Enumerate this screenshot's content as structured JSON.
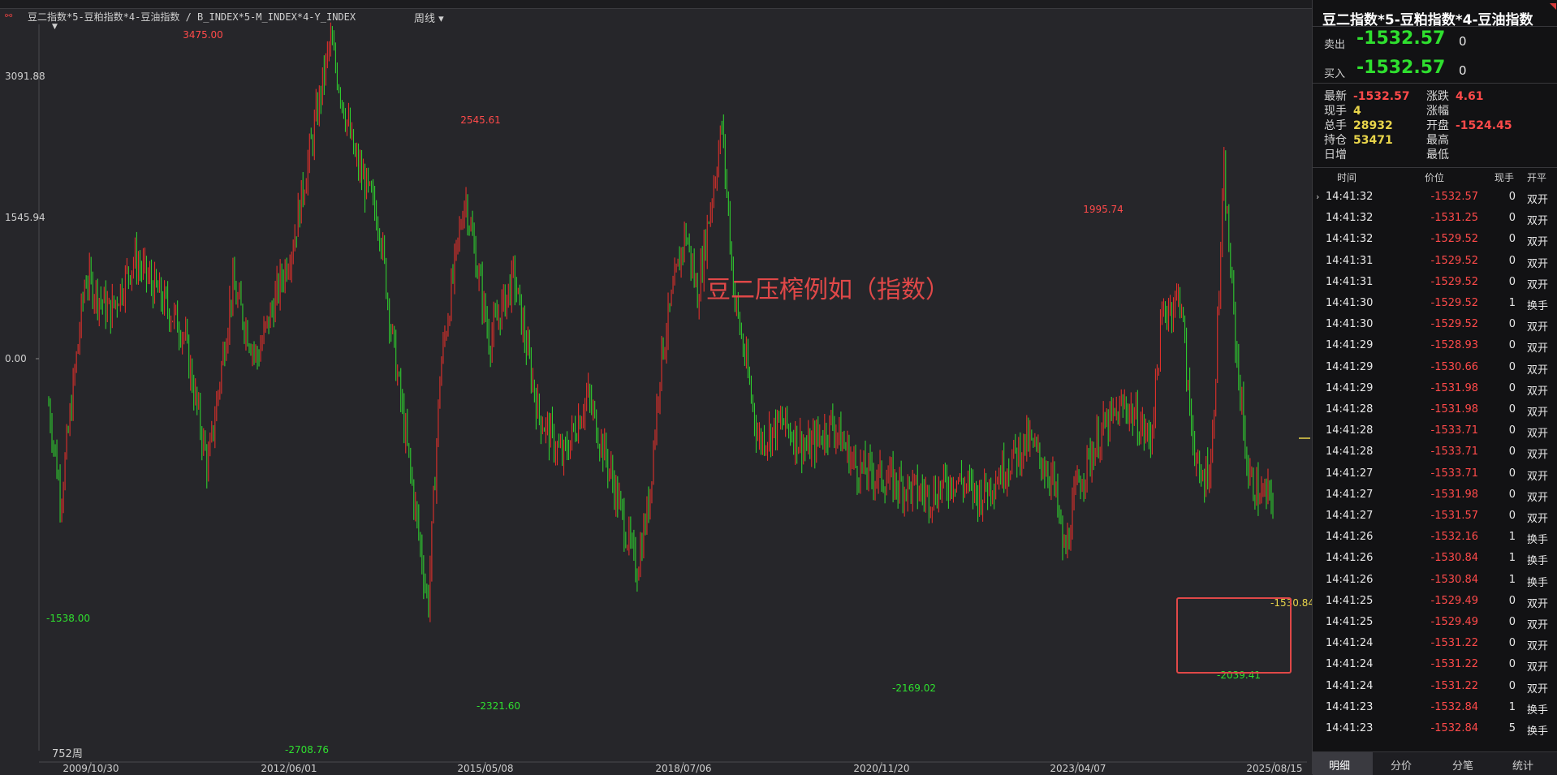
{
  "window": {
    "title": "豆二指数*5-豆粕指数*4-豆油指数 / B_INDEX*5-M_INDEX*4-Y_INDEX",
    "period": "周线 ▾",
    "bar_count_label": "752周",
    "overlay_title": "豆二压榨例如（指数）"
  },
  "chart_data": {
    "type": "candlestick",
    "y_ticks": [
      "3091.88",
      "1545.94",
      "0.00"
    ],
    "x_ticks": [
      "2009/10/30",
      "2012/06/01",
      "2015/05/08",
      "2018/07/06",
      "2020/11/20",
      "2023/04/07",
      "2025/08/15"
    ],
    "ylim": [
      -2830,
      3700
    ],
    "annotations": [
      {
        "label": "3475.00",
        "x": "2012/01",
        "y": 3475.0,
        "color": "red"
      },
      {
        "label": "2545.61",
        "x": "2016/09",
        "y": 2545.61,
        "color": "red"
      },
      {
        "label": "1995.74",
        "x": "2024/02",
        "y": 1995.74,
        "color": "red"
      },
      {
        "label": "-1538.00",
        "x": "2009/11",
        "y": -1538.0,
        "color": "green"
      },
      {
        "label": "-2708.76",
        "x": "2012/08",
        "y": -2708.76,
        "color": "green"
      },
      {
        "label": "-2321.60",
        "x": "2015/11",
        "y": -2321.6,
        "color": "green"
      },
      {
        "label": "-2169.02",
        "x": "2021/04",
        "y": -2169.02,
        "color": "green"
      },
      {
        "label": "-2039.41",
        "x": "2025/02",
        "y": -2039.41,
        "color": "green"
      },
      {
        "label": "-1530.84",
        "x": "2025/08",
        "y": -1530.84,
        "color": "yellow"
      }
    ],
    "path": [
      [
        0,
        -500
      ],
      [
        0.01,
        -1538
      ],
      [
        0.03,
        900
      ],
      [
        0.05,
        500
      ],
      [
        0.07,
        1100
      ],
      [
        0.09,
        700
      ],
      [
        0.11,
        300
      ],
      [
        0.13,
        -1200
      ],
      [
        0.15,
        800
      ],
      [
        0.17,
        0
      ],
      [
        0.2,
        1300
      ],
      [
        0.23,
        3475
      ],
      [
        0.25,
        2200
      ],
      [
        0.27,
        1500
      ],
      [
        0.28,
        300
      ],
      [
        0.3,
        -1700
      ],
      [
        0.31,
        -2708.76
      ],
      [
        0.32,
        -100
      ],
      [
        0.34,
        1800
      ],
      [
        0.36,
        200
      ],
      [
        0.38,
        900
      ],
      [
        0.4,
        -600
      ],
      [
        0.42,
        -1100
      ],
      [
        0.44,
        -400
      ],
      [
        0.46,
        -1300
      ],
      [
        0.48,
        -2321.6
      ],
      [
        0.49,
        -1600
      ],
      [
        0.5,
        0
      ],
      [
        0.52,
        1400
      ],
      [
        0.53,
        700
      ],
      [
        0.55,
        2545.61
      ],
      [
        0.56,
        700
      ],
      [
        0.57,
        -100
      ],
      [
        0.58,
        -900
      ],
      [
        0.6,
        -700
      ],
      [
        0.62,
        -1000
      ],
      [
        0.64,
        -700
      ],
      [
        0.66,
        -1200
      ],
      [
        0.68,
        -1300
      ],
      [
        0.7,
        -1400
      ],
      [
        0.72,
        -1500
      ],
      [
        0.74,
        -1300
      ],
      [
        0.76,
        -1500
      ],
      [
        0.78,
        -1200
      ],
      [
        0.8,
        -900
      ],
      [
        0.82,
        -1300
      ],
      [
        0.83,
        -2169.02
      ],
      [
        0.84,
        -1400
      ],
      [
        0.86,
        -800
      ],
      [
        0.88,
        -500
      ],
      [
        0.9,
        -900
      ],
      [
        0.91,
        500
      ],
      [
        0.925,
        700
      ],
      [
        0.93,
        -300
      ],
      [
        0.94,
        -1400
      ],
      [
        0.95,
        -1100
      ],
      [
        0.96,
        1995.74
      ],
      [
        0.97,
        100
      ],
      [
        0.98,
        -1300
      ],
      [
        0.99,
        -1500
      ],
      [
        1.0,
        -1530.84
      ]
    ],
    "highlight_box": {
      "from": "2024/10",
      "to": "2025/08"
    }
  },
  "panel": {
    "title": "豆二指数*5-豆粕指数*4-豆油指数",
    "sell_label": "卖出",
    "sell_price": "-1532.57",
    "sell_qty": "0",
    "buy_label": "买入",
    "buy_price": "-1532.57",
    "buy_qty": "0",
    "stats": [
      {
        "label": "最新",
        "value": "-1532.57",
        "color": "red"
      },
      {
        "label": "涨跌",
        "value": "4.61",
        "color": "red"
      },
      {
        "label": "现手",
        "value": "4",
        "color": "yellow"
      },
      {
        "label": "涨幅",
        "value": "",
        "color": "red"
      },
      {
        "label": "总手",
        "value": "28932",
        "color": "yellow"
      },
      {
        "label": "开盘",
        "value": "-1524.45",
        "color": "red"
      },
      {
        "label": "持仓",
        "value": "53471",
        "color": "yellow"
      },
      {
        "label": "最高",
        "value": "",
        "color": "red"
      },
      {
        "label": "日增",
        "value": "",
        "color": "yellow"
      },
      {
        "label": "最低",
        "value": "",
        "color": "red"
      }
    ],
    "headers": {
      "time": "时间",
      "price": "价位",
      "vol": "现手",
      "type": "开平"
    },
    "trades": [
      {
        "t": "14:41:32",
        "p": "-1532.57",
        "v": "0",
        "k": "双开"
      },
      {
        "t": "14:41:32",
        "p": "-1531.25",
        "v": "0",
        "k": "双开"
      },
      {
        "t": "14:41:32",
        "p": "-1529.52",
        "v": "0",
        "k": "双开"
      },
      {
        "t": "14:41:31",
        "p": "-1529.52",
        "v": "0",
        "k": "双开"
      },
      {
        "t": "14:41:31",
        "p": "-1529.52",
        "v": "0",
        "k": "双开"
      },
      {
        "t": "14:41:30",
        "p": "-1529.52",
        "v": "1",
        "k": "换手"
      },
      {
        "t": "14:41:30",
        "p": "-1529.52",
        "v": "0",
        "k": "双开"
      },
      {
        "t": "14:41:29",
        "p": "-1528.93",
        "v": "0",
        "k": "双开"
      },
      {
        "t": "14:41:29",
        "p": "-1530.66",
        "v": "0",
        "k": "双开"
      },
      {
        "t": "14:41:29",
        "p": "-1531.98",
        "v": "0",
        "k": "双开"
      },
      {
        "t": "14:41:28",
        "p": "-1531.98",
        "v": "0",
        "k": "双开"
      },
      {
        "t": "14:41:28",
        "p": "-1533.71",
        "v": "0",
        "k": "双开"
      },
      {
        "t": "14:41:28",
        "p": "-1533.71",
        "v": "0",
        "k": "双开"
      },
      {
        "t": "14:41:27",
        "p": "-1533.71",
        "v": "0",
        "k": "双开"
      },
      {
        "t": "14:41:27",
        "p": "-1531.98",
        "v": "0",
        "k": "双开"
      },
      {
        "t": "14:41:27",
        "p": "-1531.57",
        "v": "0",
        "k": "双开"
      },
      {
        "t": "14:41:26",
        "p": "-1532.16",
        "v": "1",
        "k": "换手"
      },
      {
        "t": "14:41:26",
        "p": "-1530.84",
        "v": "1",
        "k": "换手"
      },
      {
        "t": "14:41:26",
        "p": "-1530.84",
        "v": "1",
        "k": "换手"
      },
      {
        "t": "14:41:25",
        "p": "-1529.49",
        "v": "0",
        "k": "双开"
      },
      {
        "t": "14:41:25",
        "p": "-1529.49",
        "v": "0",
        "k": "双开"
      },
      {
        "t": "14:41:24",
        "p": "-1531.22",
        "v": "0",
        "k": "双开"
      },
      {
        "t": "14:41:24",
        "p": "-1531.22",
        "v": "0",
        "k": "双开"
      },
      {
        "t": "14:41:24",
        "p": "-1531.22",
        "v": "0",
        "k": "双开"
      },
      {
        "t": "14:41:23",
        "p": "-1532.84",
        "v": "1",
        "k": "换手"
      },
      {
        "t": "14:41:23",
        "p": "-1532.84",
        "v": "5",
        "k": "换手"
      }
    ],
    "tabs": [
      "明细",
      "分价",
      "分笔",
      "统计"
    ]
  }
}
